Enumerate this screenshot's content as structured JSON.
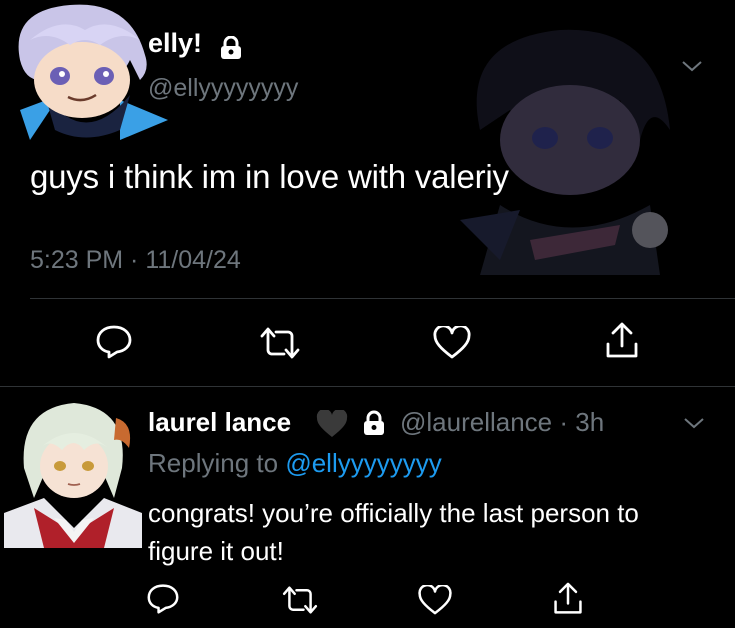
{
  "tweet": {
    "display_name": "elly!",
    "handle": "@ellyyyyyyyy",
    "text_start": "guys i think im in love with ",
    "text_end": "valeriy",
    "timestamp": "5:23 PM · 11/04/24",
    "actions": [
      "reply-icon",
      "retweet-icon",
      "like-icon",
      "share-icon"
    ]
  },
  "reply": {
    "display_name": "laurel lance",
    "handle_time": "@laurellance · 3h",
    "replying_prefix": "Replying to ",
    "replying_handle": "@ellyyyyyyyy",
    "text": "congrats! you’re officially the last person to figure it out!",
    "actions": [
      "reply-icon",
      "retweet-icon",
      "like-icon",
      "share-icon"
    ]
  },
  "colors": {
    "background": "#000000",
    "text": "#ffffff",
    "muted": "#6e767d",
    "link": "#1d9bf0",
    "divider": "#2f3336"
  }
}
